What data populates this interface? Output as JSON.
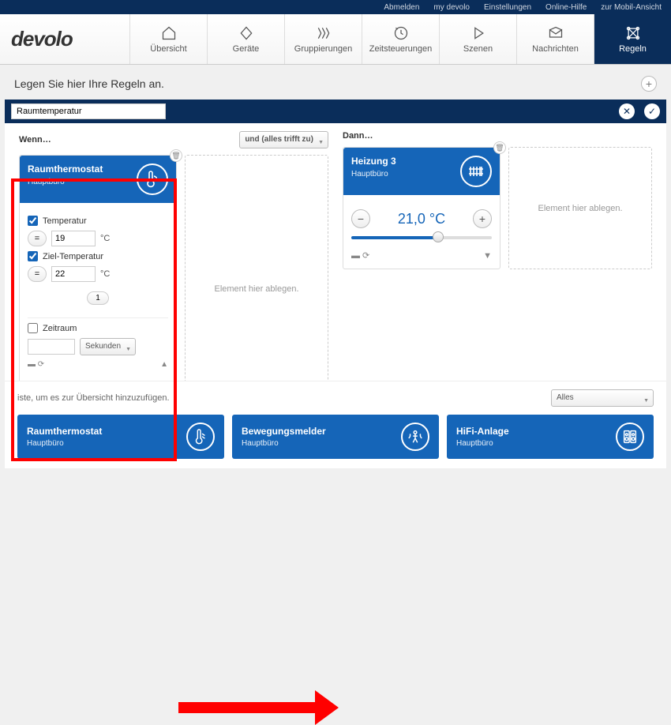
{
  "topbar": [
    "Abmelden",
    "my devolo",
    "Einstellungen",
    "Online-Hilfe",
    "zur Mobil-Ansicht"
  ],
  "logo": "devolo",
  "nav": [
    {
      "label": "Übersicht",
      "icon": "home"
    },
    {
      "label": "Geräte",
      "icon": "diamond"
    },
    {
      "label": "Gruppierungen",
      "icon": "triple"
    },
    {
      "label": "Zeitsteuerungen",
      "icon": "clock"
    },
    {
      "label": "Szenen",
      "icon": "play"
    },
    {
      "label": "Nachrichten",
      "icon": "mail"
    },
    {
      "label": "Regeln",
      "icon": "net",
      "active": true
    }
  ],
  "page_title": "Legen Sie hier Ihre Regeln an.",
  "rule_name": "Raumtemperatur",
  "when": {
    "label": "Wenn…",
    "logic": "und (alles trifft zu)",
    "card": {
      "title": "Raumthermostat",
      "sub": "Hauptbüro",
      "temp": {
        "label": "Temperatur",
        "op": "=",
        "val": "19",
        "unit": "°C",
        "checked": true
      },
      "target": {
        "label": "Ziel-Temperatur",
        "op": "=",
        "val": "22",
        "unit": "°C",
        "checked": true
      },
      "badge": "1",
      "period": {
        "label": "Zeitraum",
        "unit": "Sekunden",
        "checked": false
      }
    },
    "drop": "Element hier ablegen."
  },
  "then": {
    "label": "Dann…",
    "card": {
      "title": "Heizung 3",
      "sub": "Hauptbüro",
      "temp": "21,0 °C"
    },
    "drop": "Element hier ablegen."
  },
  "bottom": {
    "text": "iste, um es zur Übersicht hinzuzufügen.",
    "filter": "Alles",
    "devices": [
      {
        "name": "Raumthermostat",
        "sub": "Hauptbüro",
        "icon": "therm"
      },
      {
        "name": "Bewegungsmelder",
        "sub": "Hauptbüro",
        "icon": "motion"
      },
      {
        "name": "HiFi-Anlage",
        "sub": "Hauptbüro",
        "icon": "hifi"
      }
    ]
  }
}
